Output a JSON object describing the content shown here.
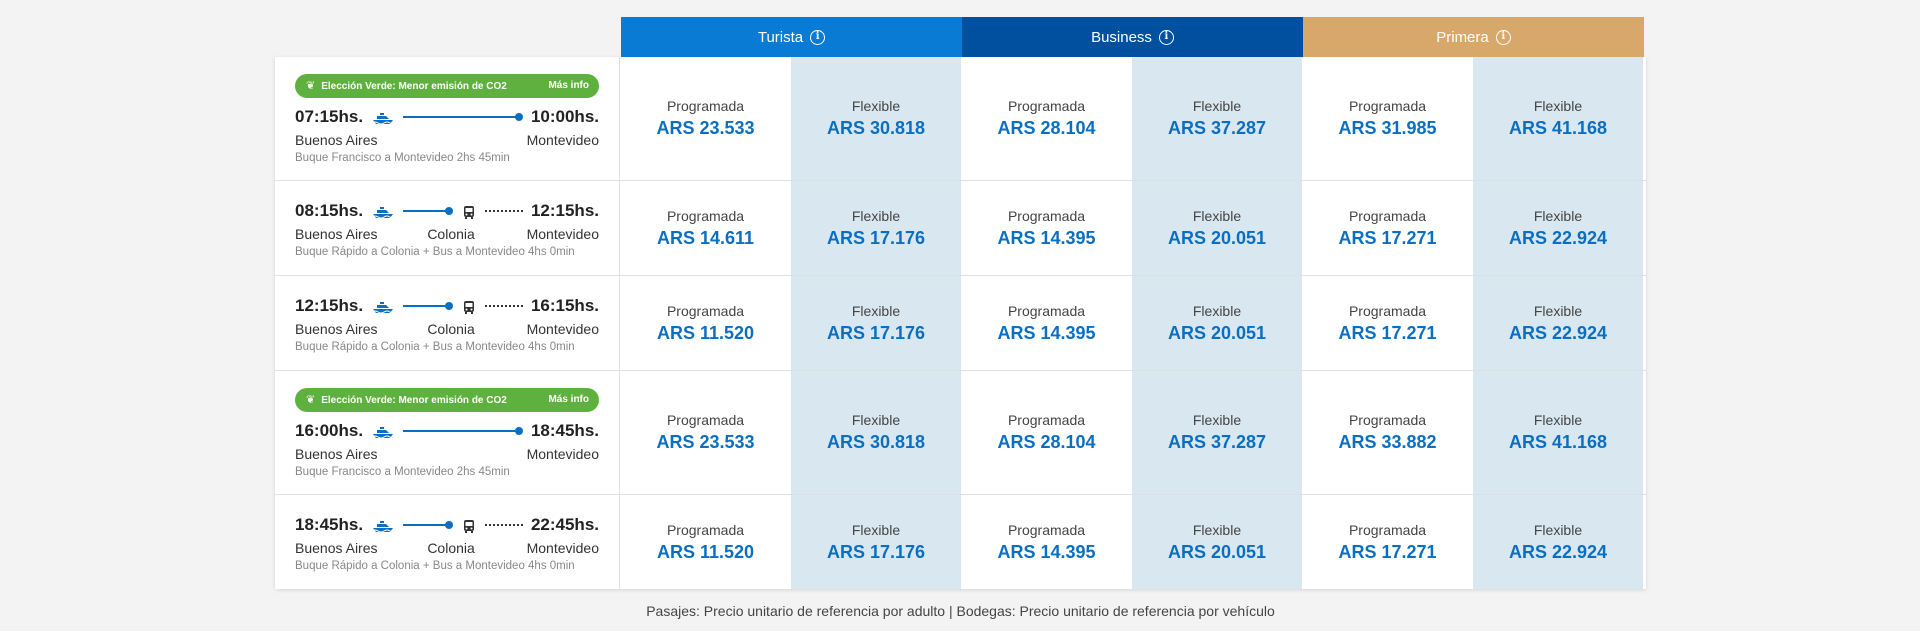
{
  "header": {
    "classes": [
      {
        "name": "Turista",
        "color": "#0a7bd5"
      },
      {
        "name": "Business",
        "color": "#0050a0"
      },
      {
        "name": "Primera",
        "color": "#d8a76a"
      }
    ],
    "info_icon": "info-icon"
  },
  "fare_labels": {
    "programmed": "Programada",
    "flexible": "Flexible"
  },
  "rows": [
    {
      "green": true,
      "badge_text": "Elección Verde: Menor emisión de CO2",
      "badge_link": "Más info",
      "depart": "07:15hs.",
      "arrive": "10:00hs.",
      "origin": "Buenos Aires",
      "via": "",
      "destination": "Montevideo",
      "description": "Buque Francisco a Montevideo 2hs 45min",
      "prices": [
        "ARS 23.533",
        "ARS 30.818",
        "ARS 28.104",
        "ARS 37.287",
        "ARS 31.985",
        "ARS 41.168"
      ]
    },
    {
      "green": false,
      "depart": "08:15hs.",
      "arrive": "12:15hs.",
      "origin": "Buenos Aires",
      "via": "Colonia",
      "destination": "Montevideo",
      "description": "Buque Rápido a Colonia + Bus a Montevideo 4hs 0min",
      "prices": [
        "ARS 14.611",
        "ARS 17.176",
        "ARS 14.395",
        "ARS 20.051",
        "ARS 17.271",
        "ARS 22.924"
      ]
    },
    {
      "green": false,
      "depart": "12:15hs.",
      "arrive": "16:15hs.",
      "origin": "Buenos Aires",
      "via": "Colonia",
      "destination": "Montevideo",
      "description": "Buque Rápido a Colonia + Bus a Montevideo 4hs 0min",
      "prices": [
        "ARS 11.520",
        "ARS 17.176",
        "ARS 14.395",
        "ARS 20.051",
        "ARS 17.271",
        "ARS 22.924"
      ]
    },
    {
      "green": true,
      "badge_text": "Elección Verde: Menor emisión de CO2",
      "badge_link": "Más info",
      "depart": "16:00hs.",
      "arrive": "18:45hs.",
      "origin": "Buenos Aires",
      "via": "",
      "destination": "Montevideo",
      "description": "Buque Francisco a Montevideo 2hs 45min",
      "prices": [
        "ARS 23.533",
        "ARS 30.818",
        "ARS 28.104",
        "ARS 37.287",
        "ARS 33.882",
        "ARS 41.168"
      ]
    },
    {
      "green": false,
      "depart": "18:45hs.",
      "arrive": "22:45hs.",
      "origin": "Buenos Aires",
      "via": "Colonia",
      "destination": "Montevideo",
      "description": "Buque Rápido a Colonia + Bus a Montevideo 4hs 0min",
      "prices": [
        "ARS 11.520",
        "ARS 17.176",
        "ARS 14.395",
        "ARS 20.051",
        "ARS 17.271",
        "ARS 22.924"
      ]
    }
  ],
  "footer": "Pasajes: Precio unitario de referencia por adulto | Bodegas: Precio unitario de referencia por vehículo"
}
